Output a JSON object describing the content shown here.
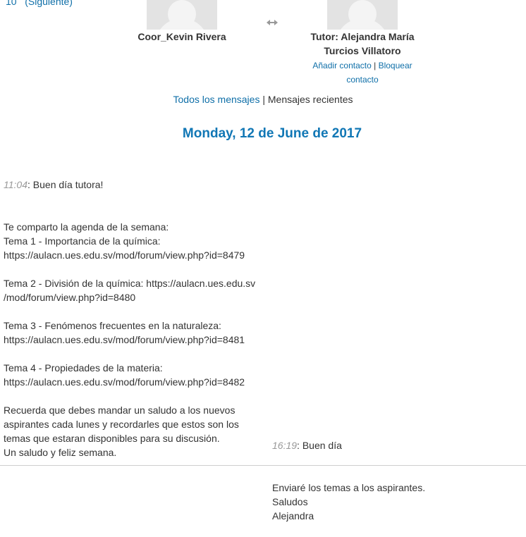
{
  "pager": {
    "prefix": "10",
    "next_label": "(Siguiente)"
  },
  "conversation": {
    "left_user": "Coor_Kevin Rivera",
    "right_user_line1": "Tutor: Alejandra María",
    "right_user_line2": "Turcios Villatoro",
    "add_contact": "Añadir contacto",
    "separator": "|",
    "block": "Bloquear",
    "contact_word": "contacto"
  },
  "filters": {
    "all_messages": "Todos los mensajes",
    "separator": "|",
    "recent_messages": "Mensajes recientes"
  },
  "date_heading": "Monday, 12 de June de 2017",
  "messages": [
    {
      "time": "11:04",
      "first_line": ": Buen día tutora!",
      "body": "Te comparto la agenda de la semana:\nTema 1 - Importancia de la química:\nhttps://aulacn.ues.edu.sv/mod/forum/view.php?id=8479\n\nTema 2 - División de la química: https://aulacn.ues.edu.sv\n/mod/forum/view.php?id=8480\n\nTema 3 - Fenómenos frecuentes en la naturaleza:\nhttps://aulacn.ues.edu.sv/mod/forum/view.php?id=8481\n\nTema 4 - Propiedades de la materia:\nhttps://aulacn.ues.edu.sv/mod/forum/view.php?id=8482\n\nRecuerda que debes mandar un saludo a los nuevos\naspirantes cada lunes y recordarles que estos son los\ntemas que estaran disponibles para su discusión.\nUn saludo y feliz semana."
    },
    {
      "time": "16:19",
      "first_line": ": Buen día",
      "body": "Enviaré los temas a los aspirantes.\nSaludos\nAlejandra"
    }
  ],
  "icons": {
    "swap": "swap-arrows-icon",
    "avatar": "default-avatar-icon"
  },
  "colors": {
    "link": "#0f6fa8",
    "heading": "#1177b5",
    "timestamp": "#999999"
  }
}
